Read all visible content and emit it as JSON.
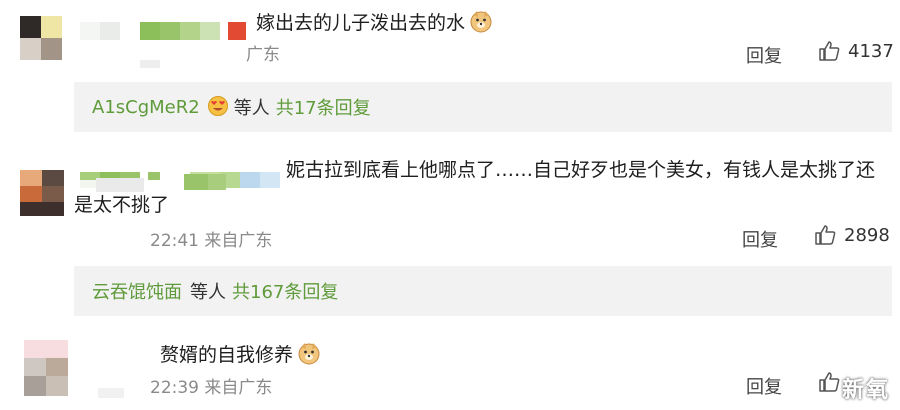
{
  "comments": [
    {
      "text": "嫁出去的儿子泼出去的水",
      "emoji": "doge-icon",
      "location": "广东",
      "reply_label": "回复",
      "likes": "4137",
      "sub_reply": {
        "user": "A1sCgMeR2",
        "etc_label": "等人",
        "count_label": "共17条回复"
      }
    },
    {
      "text_line1": "妮古拉到底看上他哪点了……自己好歹也是个美女，有钱人是太挑了还",
      "text_line2": "是太不挑了",
      "time": "22:41",
      "location": "来自广东",
      "reply_label": "回复",
      "likes": "2898",
      "sub_reply": {
        "user": "云吞馄饨面",
        "etc_label": "等人",
        "count_label": "共167条回复"
      }
    },
    {
      "text": "赘婿的自我修养",
      "emoji": "doge-icon",
      "time": "22:39",
      "location": "来自广东",
      "reply_label": "回复"
    }
  ],
  "watermark": "新氧",
  "colors": {
    "link_green": "#5f9b3a",
    "summary_bg": "#f2f2f2"
  }
}
